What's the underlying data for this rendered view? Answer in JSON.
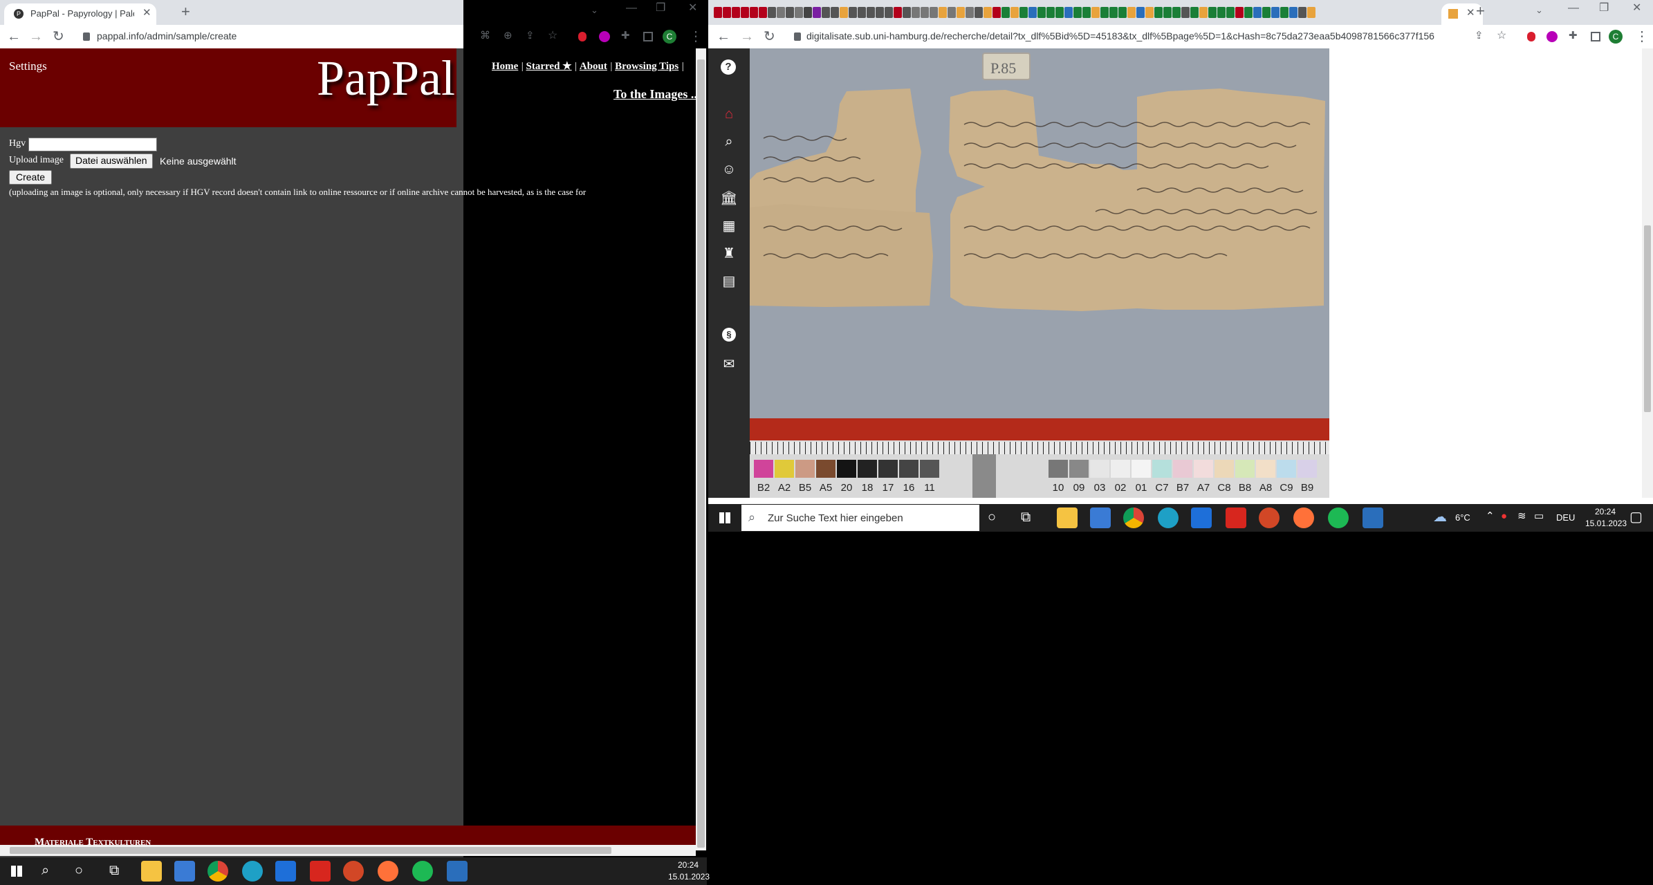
{
  "left_window": {
    "tab_title": "PapPal - Papyrology | Paleograph",
    "url": "pappal.info/admin/sample/create",
    "header": {
      "settings_label": "Settings",
      "logo_text": "PapPal",
      "nav_links": [
        "Home",
        "Starred ★",
        "About",
        "Browsing Tips"
      ],
      "images_link": "To the Images ..."
    },
    "form": {
      "hgv_label": "Hgv",
      "hgv_value": "",
      "upload_label": "Upload image",
      "file_button": "Datei auswählen",
      "file_status": "Keine ausgewählt",
      "create_button": "Create",
      "note": "(uploading an image is optional, only necessary if HGV record doesn't contain link to online ressource or if online archive cannot be harvested, as is the case for"
    },
    "footer_text": "Materiale Textkulturen",
    "taskbar": {
      "time": "20:24",
      "date": "15.01.2023"
    }
  },
  "right_window": {
    "url": "digitalisate.sub.uni-hamburg.de/recherche/detail?tx_dlf%5Bid%5D=45183&tx_dlf%5Bpage%5D=1&cHash=8c75da273eaa5b4098781566c377f156",
    "papyrus_label": "P.85",
    "color_chart_left": [
      "B2",
      "A2",
      "B5",
      "A5",
      "20",
      "18",
      "17",
      "16",
      "11"
    ],
    "color_chart_right": [
      "10",
      "09",
      "03",
      "02",
      "01",
      "C7",
      "B7",
      "A7",
      "C8",
      "B8",
      "A8",
      "C9",
      "B9"
    ],
    "taskbar": {
      "search_placeholder": "Zur Suche Text hier eingeben",
      "weather": "6°C",
      "language": "DEU",
      "time": "20:24",
      "date": "15.01.2023"
    }
  },
  "colors": {
    "pappal_red": "#6b0000",
    "pappal_body": "#3f3f3f",
    "chrome_tabs": "#dee1e6",
    "sidebar_dark": "#2b2b2b",
    "papyrus": "#c9b08a",
    "scan_bg": "#9aa2ad"
  }
}
